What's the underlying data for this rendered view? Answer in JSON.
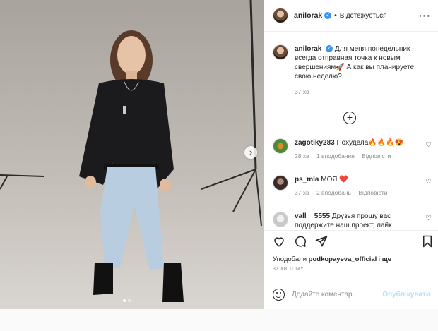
{
  "header": {
    "username": "anilorak",
    "verified": "✓",
    "separator": "•",
    "follow_status": "Відстежується",
    "more": "···"
  },
  "caption": {
    "username": "anilorak",
    "verified": "✓",
    "text": "Для меня понедельник – всегда отправная точка к новым свершениям🚀 А как вы планируете свою неделю?",
    "time": "37 хв"
  },
  "load_more": "+",
  "comments": [
    {
      "username": "zagotiky283",
      "text": "Похудела🔥🔥🔥😍",
      "time": "28 хв",
      "likes": "1 вподобання",
      "reply": "Відповісти"
    },
    {
      "username": "ps_mla",
      "text": "МОЯ ❤️",
      "time": "37 хв",
      "likes": "2 вподобань",
      "reply": "Відповісти"
    },
    {
      "username": "vall__5555",
      "text": "Друзья прошу вас поддержите наш проект, лайк",
      "time": "",
      "likes": "",
      "reply": ""
    }
  ],
  "actions": {
    "like": "♡",
    "comment": "💬",
    "share": "➤",
    "save": "🔖"
  },
  "likes": {
    "prefix": "Уподобали",
    "user": "podkopayeva_official",
    "and": "і",
    "more": "ще"
  },
  "posted_ago": "37 ХВ ТОМУ",
  "comment_box": {
    "placeholder": "Додайте коментар...",
    "publish": "Опублікувати"
  },
  "carousel": {
    "next": "›"
  },
  "colors": {
    "link": "#3897f0",
    "publish": "#b2dffc",
    "muted": "#8e8e8e"
  }
}
